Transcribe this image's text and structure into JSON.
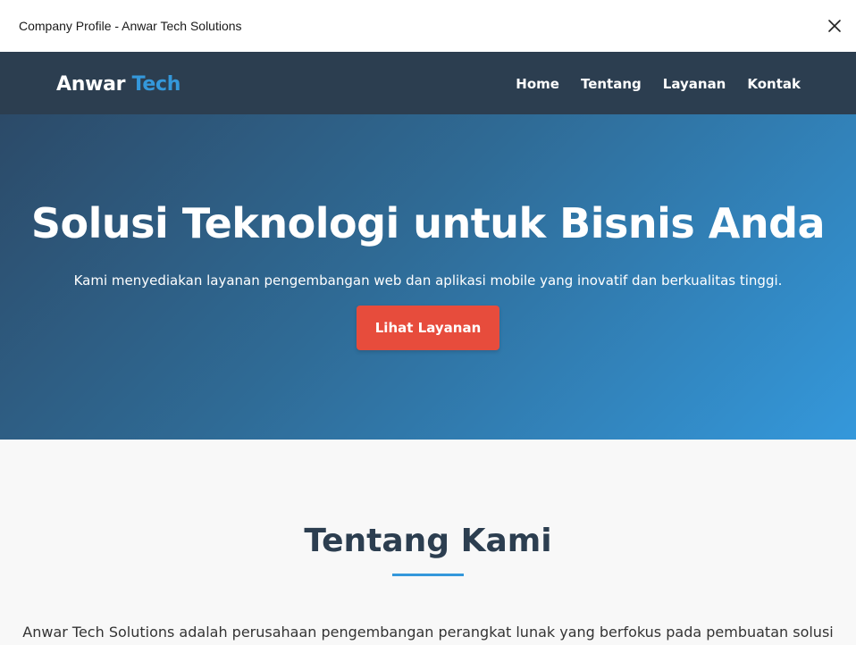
{
  "window": {
    "title": "Company Profile - Anwar Tech Solutions",
    "close_icon": "close-icon"
  },
  "navbar": {
    "logo_main": "Anwar",
    "logo_accent": "Tech",
    "links": [
      "Home",
      "Tentang",
      "Layanan",
      "Kontak"
    ]
  },
  "hero": {
    "title": "Solusi Teknologi untuk Bisnis Anda",
    "subtitle": "Kami menyediakan layanan pengembangan web dan aplikasi mobile yang inovatif dan berkualitas tinggi.",
    "button_label": "Lihat Layanan"
  },
  "about": {
    "title": "Tentang Kami",
    "text": "Anwar Tech Solutions adalah perusahaan pengembangan perangkat lunak yang berfokus pada pembuatan solusi"
  },
  "colors": {
    "navbar_bg": "#2c3e50",
    "accent": "#3498db",
    "cta": "#e74c3c",
    "section_bg": "#f8f8f8"
  }
}
